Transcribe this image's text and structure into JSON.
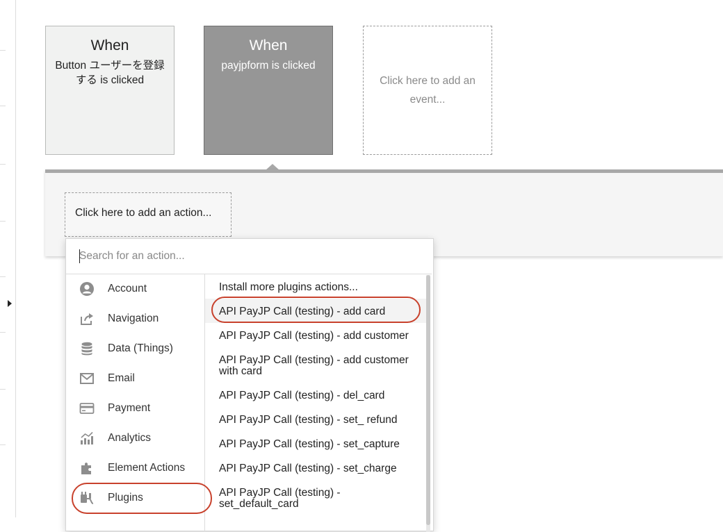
{
  "events": [
    {
      "when": "When",
      "description": "Button ユーザーを登録する is clicked"
    },
    {
      "when": "When",
      "description": "payjpform is clicked"
    }
  ],
  "add_event_placeholder": "Click here to add an event...",
  "add_action_placeholder": "Click here to add an action...",
  "search": {
    "placeholder": "Search for an action..."
  },
  "categories": [
    {
      "label": "Account",
      "icon": "account-icon"
    },
    {
      "label": "Navigation",
      "icon": "navigation-icon"
    },
    {
      "label": "Data (Things)",
      "icon": "database-icon"
    },
    {
      "label": "Email",
      "icon": "email-icon"
    },
    {
      "label": "Payment",
      "icon": "payment-card-icon"
    },
    {
      "label": "Analytics",
      "icon": "analytics-icon"
    },
    {
      "label": "Element Actions",
      "icon": "puzzle-icon"
    },
    {
      "label": "Plugins",
      "icon": "plugin-icon"
    }
  ],
  "actions": [
    "Install more plugins actions...",
    "API PayJP Call (testing) - add card",
    "API PayJP Call (testing) - add customer",
    "API PayJP Call (testing) - add customer with card",
    "API PayJP Call (testing) - del_card",
    "API PayJP Call (testing) - set_ refund",
    "API PayJP Call (testing) - set_capture",
    "API PayJP Call (testing) - set_charge",
    "API PayJP Call (testing) - set_default_card"
  ],
  "colors": {
    "highlight": "#c8412c",
    "selected_event_bg": "#969696",
    "panel_bar": "#a8a8a8"
  }
}
